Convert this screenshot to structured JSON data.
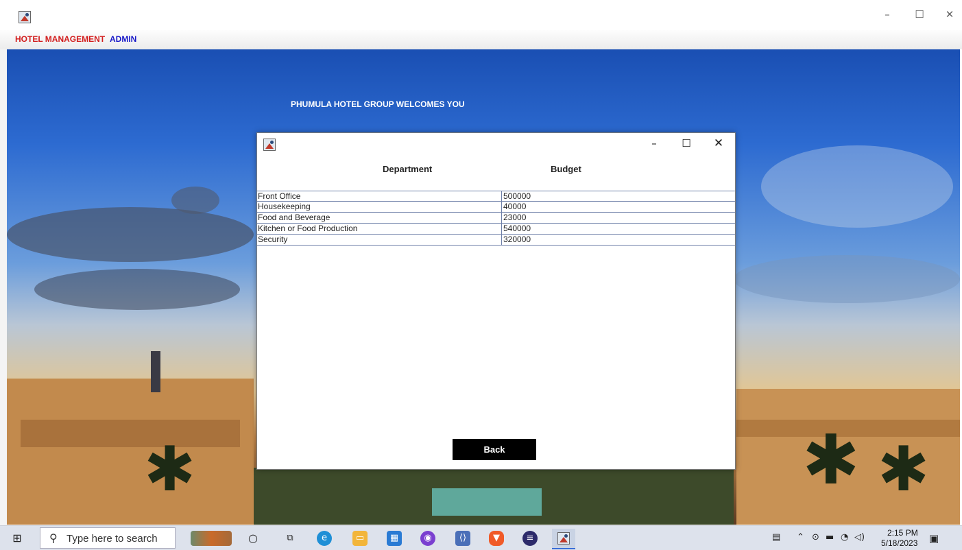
{
  "app": {
    "menu": [
      {
        "label": "HOTEL MANAGEMENT",
        "color": "#d21d1d"
      },
      {
        "label": "ADMIN",
        "color": "#1a1ac8"
      }
    ],
    "window_controls": {
      "minimize": "–",
      "maximize": "☐",
      "close": "✕"
    }
  },
  "main": {
    "welcome_text": "PHUMULA HOTEL GROUP WELCOMES YOU"
  },
  "dialog": {
    "window_controls": {
      "minimize": "–",
      "maximize": "☐",
      "close": "✕"
    },
    "columns": [
      "Department",
      "Budget"
    ],
    "rows": [
      {
        "department": "Front Office",
        "budget": "500000"
      },
      {
        "department": "Housekeeping",
        "budget": "40000"
      },
      {
        "department": "Food and Beverage",
        "budget": "23000"
      },
      {
        "department": "Kitchen or Food Production",
        "budget": "540000"
      },
      {
        "department": "Security",
        "budget": "320000"
      }
    ],
    "back_label": "Back"
  },
  "taskbar": {
    "search_placeholder": "Type here to search",
    "clock_time": "2:15 PM",
    "clock_date": "5/18/2023",
    "icons": [
      "windows-start-icon",
      "search-icon",
      "cortana-icon",
      "task-view-icon",
      "edge-icon",
      "file-explorer-icon",
      "microsoft-store-icon",
      "github-icon",
      "vscode-icon",
      "brave-icon",
      "eclipse-icon",
      "java-app-icon"
    ],
    "tray": [
      "news-widget-icon",
      "chevron-up-icon",
      "meet-icon",
      "battery-icon",
      "wifi-icon",
      "volume-icon",
      "notification-icon"
    ]
  }
}
